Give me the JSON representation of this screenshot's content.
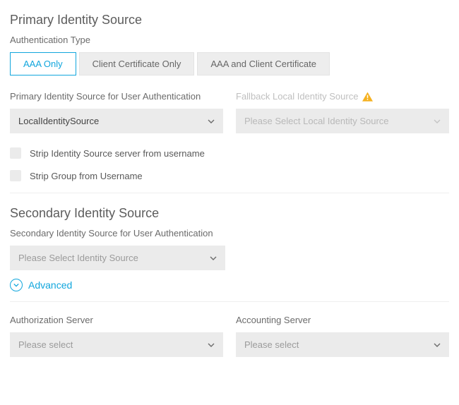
{
  "primary": {
    "heading": "Primary Identity Source",
    "auth_type_label": "Authentication Type",
    "auth_type_options": [
      "AAA Only",
      "Client Certificate Only",
      "AAA and Client Certificate"
    ],
    "auth_type_selected": "AAA Only",
    "source_label": "Primary Identity Source for User Authentication",
    "source_value": "LocalIdentitySource",
    "fallback_label": "Fallback Local Identity Source",
    "fallback_placeholder": "Please Select Local Identity Source",
    "strip_server_label": "Strip Identity Source server from username",
    "strip_group_label": "Strip Group from Username"
  },
  "secondary": {
    "heading": "Secondary Identity Source",
    "source_label": "Secondary Identity Source for User Authentication",
    "source_placeholder": "Please Select Identity Source"
  },
  "advanced_label": "Advanced",
  "authz": {
    "label": "Authorization Server",
    "placeholder": "Please select"
  },
  "acct": {
    "label": "Accounting Server",
    "placeholder": "Please select"
  }
}
